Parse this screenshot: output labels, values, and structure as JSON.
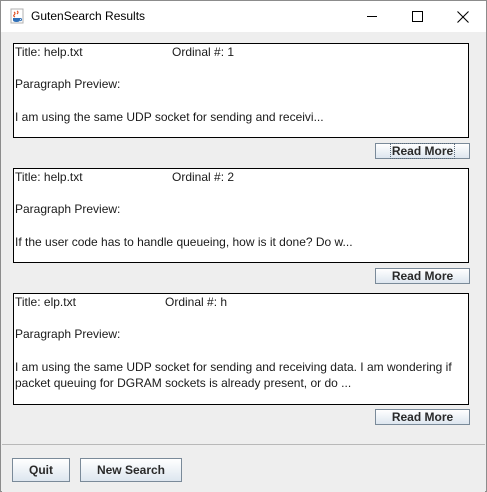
{
  "window": {
    "title": "GutenSearch Results",
    "icon": "java-coffee-cup-icon"
  },
  "results": [
    {
      "title": "Title: help.txt",
      "ordinal": "Ordinal #: 1",
      "preview_label": "Paragraph Preview:",
      "preview_text": "I am using the same UDP socket for sending and receivi...",
      "read_more_label": "Read More"
    },
    {
      "title": "Title: help.txt",
      "ordinal": "Ordinal #: 2",
      "preview_label": "Paragraph Preview:",
      "preview_text": "If the user code has to handle queueing, how is it done? Do w...",
      "read_more_label": "Read More"
    },
    {
      "title": "Title: elp.txt",
      "ordinal": "Ordinal #: h",
      "preview_label": "Paragraph Preview:",
      "preview_text": "I am using the same UDP socket for sending and receiving data. I am wondering if packet queuing for DGRAM sockets is already present, or do ...",
      "read_more_label": "Read More"
    }
  ],
  "footer": {
    "quit_label": "Quit",
    "new_search_label": "New Search"
  }
}
